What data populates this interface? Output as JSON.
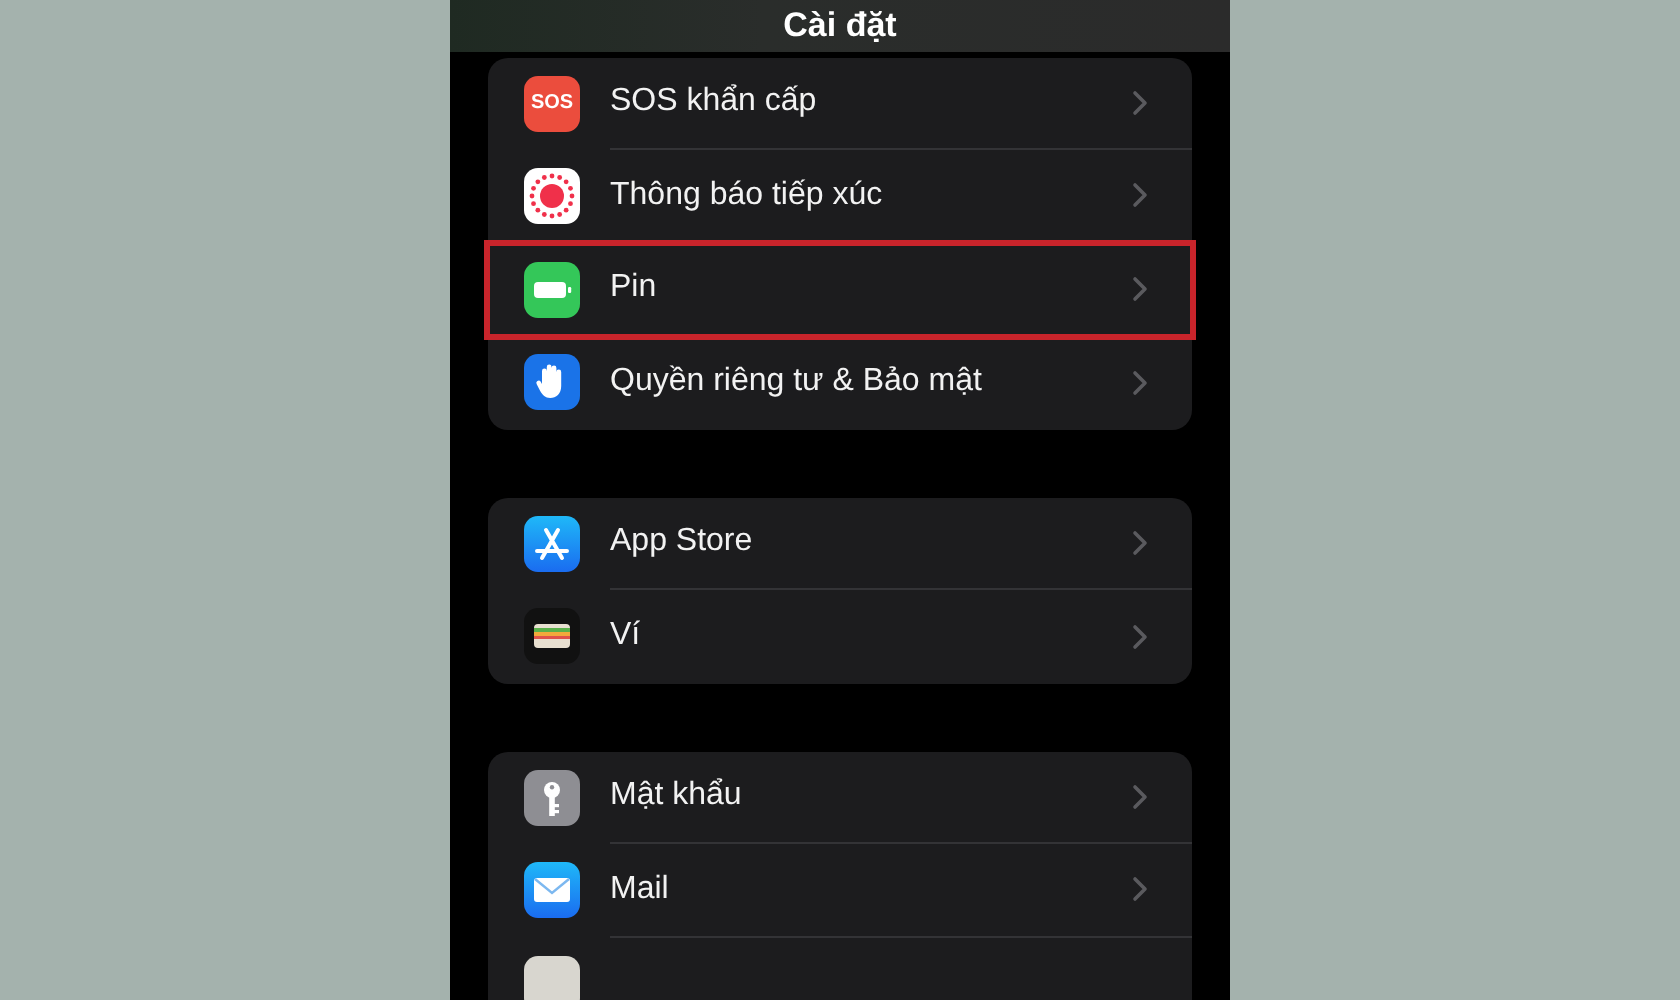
{
  "header": {
    "title": "Cài đặt"
  },
  "groups": [
    {
      "items": [
        {
          "kind": "sos",
          "label": "SOS khẩn cấp",
          "icon_text": "SOS",
          "highlighted": false
        },
        {
          "kind": "exposure",
          "label": "Thông báo tiếp xúc",
          "highlighted": false
        },
        {
          "kind": "battery",
          "label": "Pin",
          "highlighted": true
        },
        {
          "kind": "hand",
          "label": "Quyền riêng tư & Bảo mật",
          "highlighted": false
        }
      ]
    },
    {
      "items": [
        {
          "kind": "appstore",
          "label": "App Store",
          "highlighted": false
        },
        {
          "kind": "wallet",
          "label": "Ví",
          "highlighted": false
        }
      ]
    },
    {
      "items": [
        {
          "kind": "key",
          "label": "Mật khẩu",
          "highlighted": false
        },
        {
          "kind": "mail",
          "label": "Mail",
          "highlighted": false
        },
        {
          "kind": "cutoff",
          "highlighted": false
        }
      ]
    }
  ]
}
